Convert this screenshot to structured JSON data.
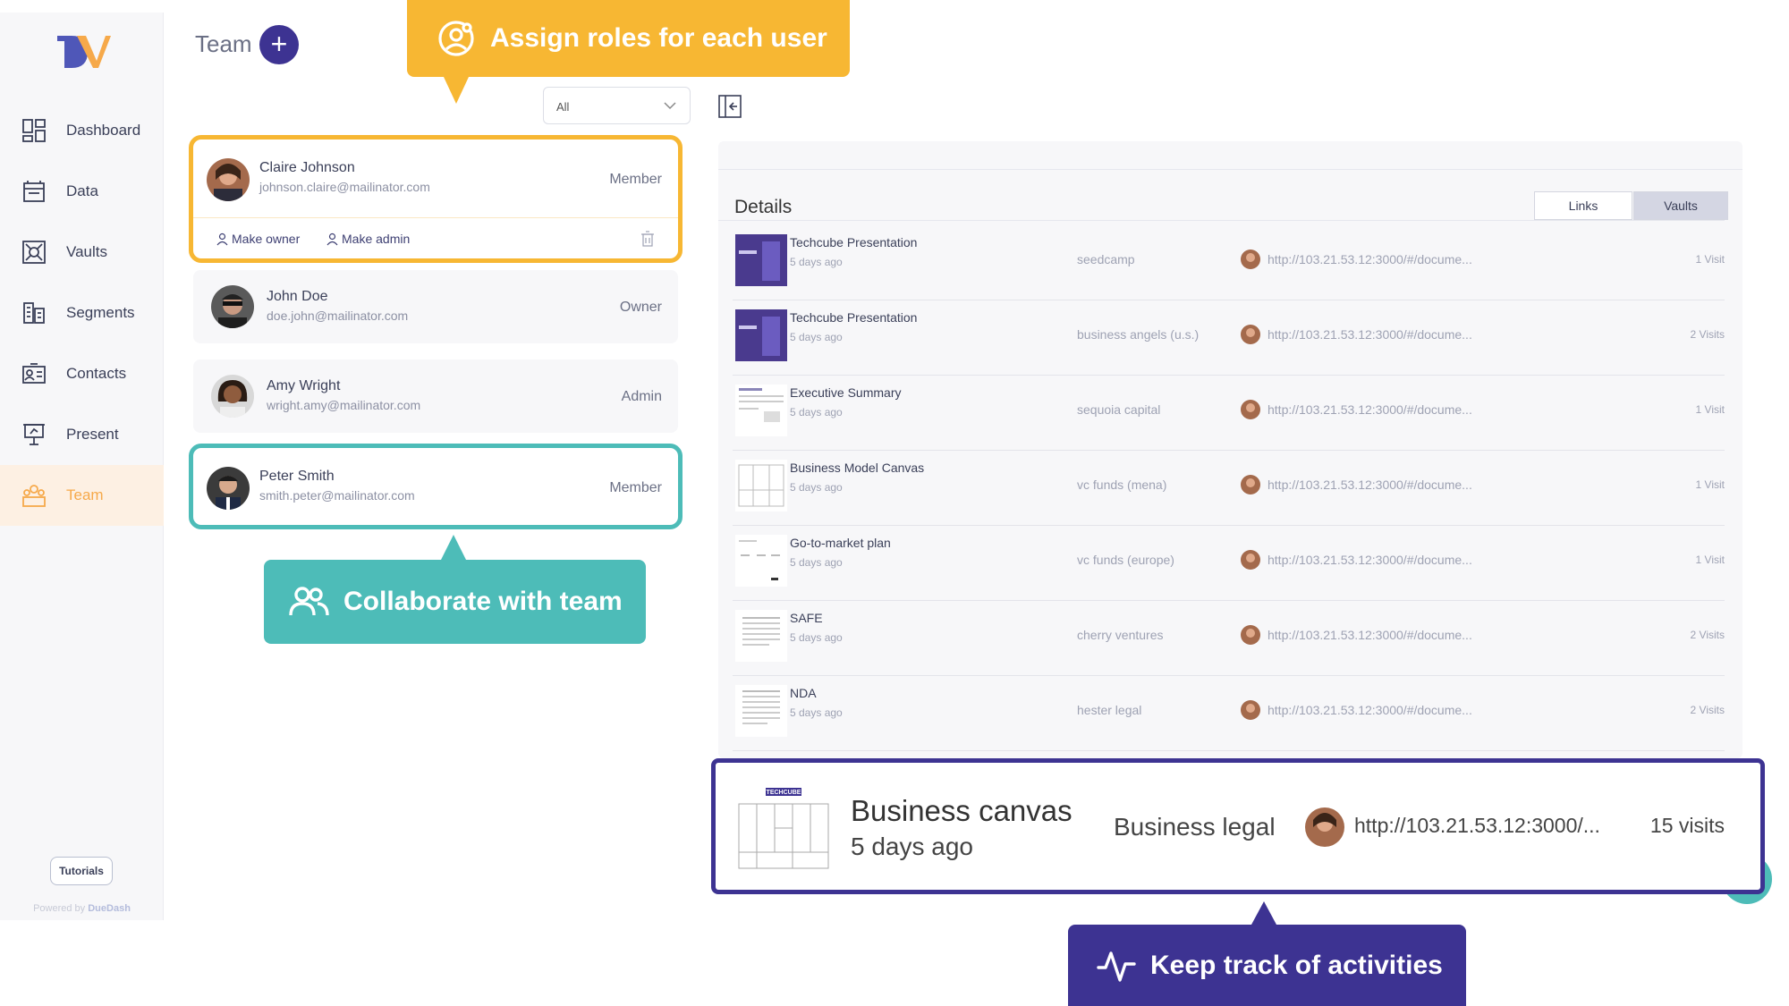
{
  "colors": {
    "accent_yellow": "#f7b733",
    "accent_teal": "#4dbcb8",
    "accent_purple": "#3d3392",
    "active_nav": "#f6a94a"
  },
  "sidebar": {
    "items": [
      {
        "label": "Dashboard",
        "icon": "dashboard-icon"
      },
      {
        "label": "Data",
        "icon": "data-icon"
      },
      {
        "label": "Vaults",
        "icon": "vaults-icon"
      },
      {
        "label": "Segments",
        "icon": "segments-icon"
      },
      {
        "label": "Contacts",
        "icon": "contacts-icon"
      },
      {
        "label": "Present",
        "icon": "present-icon"
      },
      {
        "label": "Team",
        "icon": "team-icon",
        "active": true
      }
    ],
    "tutorials_label": "Tutorials",
    "powered_prefix": "Powered by",
    "powered_brand": "DueDash"
  },
  "header": {
    "title": "Team",
    "add_label": "+"
  },
  "filter": {
    "value": "All"
  },
  "members": [
    {
      "name": "Claire Johnson",
      "email": "johnson.claire@mailinator.com",
      "role": "Member",
      "make_owner": "Make owner",
      "make_admin": "Make admin"
    },
    {
      "name": "John Doe",
      "email": "doe.john@mailinator.com",
      "role": "Owner"
    },
    {
      "name": "Amy Wright",
      "email": "wright.amy@mailinator.com",
      "role": "Admin"
    },
    {
      "name": "Peter Smith",
      "email": "smith.peter@mailinator.com",
      "role": "Member"
    }
  ],
  "callouts": {
    "assign": "Assign roles for each user",
    "collaborate": "Collaborate with team",
    "track": "Keep track of activities"
  },
  "details": {
    "title": "Details",
    "tabs": [
      "Links",
      "Vaults"
    ],
    "rows": [
      {
        "name": "Techcube Presentation",
        "time": "5 days ago",
        "vault": "seedcamp",
        "url": "http://103.21.53.12:3000/#/docume...",
        "visits": "1 Visit"
      },
      {
        "name": "Techcube Presentation",
        "time": "5 days ago",
        "vault": "business angels (u.s.)",
        "url": "http://103.21.53.12:3000/#/docume...",
        "visits": "2 Visits"
      },
      {
        "name": "Executive Summary",
        "time": "5 days ago",
        "vault": "sequoia capital",
        "url": "http://103.21.53.12:3000/#/docume...",
        "visits": "1 Visit"
      },
      {
        "name": "Business Model Canvas",
        "time": "5 days ago",
        "vault": "vc funds (mena)",
        "url": "http://103.21.53.12:3000/#/docume...",
        "visits": "1 Visit"
      },
      {
        "name": "Go-to-market plan",
        "time": "5 days ago",
        "vault": "vc funds (europe)",
        "url": "http://103.21.53.12:3000/#/docume...",
        "visits": "1 Visit"
      },
      {
        "name": "SAFE",
        "time": "5 days ago",
        "vault": "cherry ventures",
        "url": "http://103.21.53.12:3000/#/docume...",
        "visits": "2 Visits"
      },
      {
        "name": "NDA",
        "time": "5 days ago",
        "vault": "hester legal",
        "url": "http://103.21.53.12:3000/#/docume...",
        "visits": "2 Visits"
      }
    ],
    "highlight": {
      "name": "Business canvas",
      "time": "5 days ago",
      "vault": "Business legal",
      "url": "http://103.21.53.12:3000/...",
      "visits": "15 visits",
      "thumb_caption": "TECHCUBE"
    }
  }
}
